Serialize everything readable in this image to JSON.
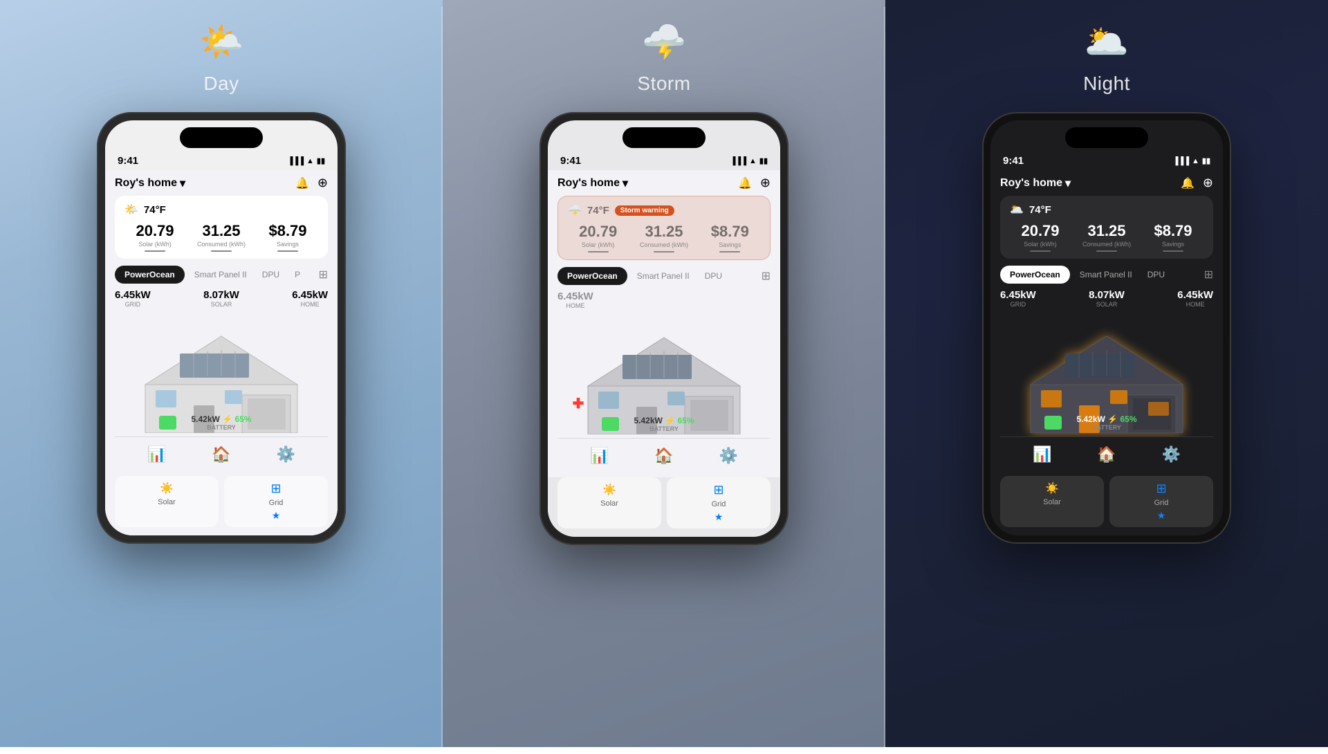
{
  "panels": [
    {
      "id": "day",
      "theme": "day",
      "weatherIcon": "🌤️",
      "weatherLabel": "Day",
      "phone": {
        "time": "9:41",
        "home": "6.45kW",
        "temp": "74°F",
        "solar": "20.79",
        "solarLabel": "Solar (kWh)",
        "consumed": "31.25",
        "consumedLabel": "Consumed (kWh)",
        "savings": "$8.79",
        "savingsLabel": "Savings",
        "activeTab": "PowerOcean",
        "tabs": [
          "PowerOcean",
          "Smart Panel II",
          "DPU"
        ],
        "grid": "6.45kW",
        "gridLabel": "GRID",
        "solar2": "8.07kW",
        "solar2Label": "SOLAR",
        "homeLabel": "HOME",
        "battery": "5.42kW",
        "batteryLabel": "BATTERY",
        "batteryPercent": "⚡ 65%",
        "navItems": [
          "📊",
          "🔵",
          "⚙️"
        ],
        "bottomCards": [
          "Solar",
          "Grid"
        ],
        "stormWarning": false
      }
    },
    {
      "id": "storm",
      "theme": "storm",
      "weatherIcon": "🌩️",
      "weatherLabel": "Storm",
      "phone": {
        "time": "9:41",
        "home": "6.45kW",
        "temp": "74°F",
        "stormBadge": "Storm warning",
        "solar": "20.79",
        "solarLabel": "Solar (kWh)",
        "consumed": "31.25",
        "consumedLabel": "Consumed (kWh)",
        "savings": "$8.79",
        "savingsLabel": "Savings",
        "activeTab": "PowerOcean",
        "tabs": [
          "PowerOcean",
          "Smart Panel II",
          "DPU"
        ],
        "grid": "",
        "gridLabel": "",
        "solar2": "",
        "solar2Label": "",
        "homeLabel": "HOME",
        "battery": "5.42kW",
        "batteryLabel": "BATTERY",
        "batteryPercent": "⚡ 65%",
        "navItems": [
          "📊",
          "🔵",
          "⚙️"
        ],
        "bottomCards": [
          "Solar",
          "Grid"
        ],
        "stormWarning": true
      }
    },
    {
      "id": "night",
      "theme": "night",
      "weatherIcon": "🌥️",
      "weatherLabel": "Night",
      "phone": {
        "time": "9:41",
        "home": "6.45kW",
        "temp": "74°F",
        "solar": "20.79",
        "solarLabel": "Solar (kWh)",
        "consumed": "31.25",
        "consumedLabel": "Consumed (kWh)",
        "savings": "$8.79",
        "savingsLabel": "Savings",
        "activeTab": "PowerOcean",
        "tabs": [
          "PowerOcean",
          "Smart Panel II",
          "DPU"
        ],
        "grid": "6.45kW",
        "gridLabel": "GRID",
        "solar2": "8.07kW",
        "solar2Label": "SOLAR",
        "homeLabel": "HOME",
        "battery": "5.42kW",
        "batteryLabel": "BATTERY",
        "batteryPercent": "⚡ 65%",
        "navItems": [
          "📊",
          "🔵",
          "⚙️"
        ],
        "bottomCards": [
          "Solar",
          "Grid"
        ],
        "stormWarning": false
      }
    }
  ]
}
